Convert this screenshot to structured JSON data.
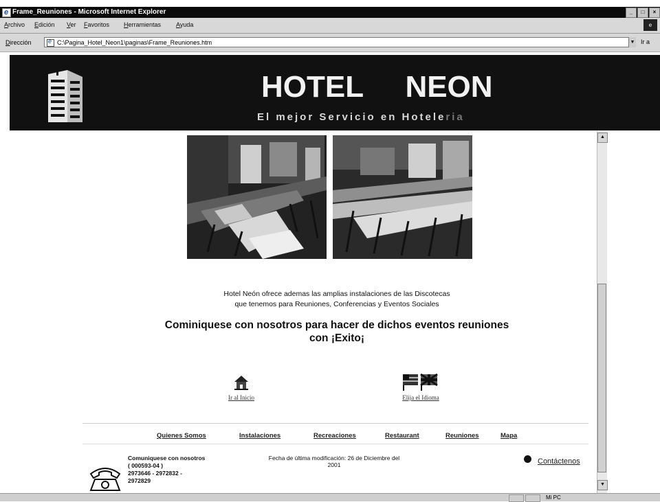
{
  "window": {
    "title": "Frame_Reuniones - Microsoft Internet Explorer"
  },
  "menu": [
    "Archivo",
    "Edición",
    "Ver",
    "Favoritos",
    "Herramientas",
    "Ayuda"
  ],
  "address": {
    "label": "Dirección",
    "value": "C:\\Pagina_Hotel_Neon1\\paginas\\Frame_Reuniones.htm",
    "go": "Ir a"
  },
  "header": {
    "title_left": "HOTEL",
    "title_right": "NEON",
    "subtitle_main": "El mejor Servicio en Hotele",
    "subtitle_fade": "ria"
  },
  "content": {
    "desc_line1": "Hotel Neón ofrece ademas las amplias instalaciones de las Discotecas",
    "desc_line2": "que tenemos para Reuniones, Conferencias y Eventos Sociales",
    "highlight_line1": "Cominiquese con nosotros para hacer de dichos eventos reuniones",
    "highlight_line2": "con ¡Exito¡"
  },
  "nav": {
    "home": "Ir al Inicio",
    "language": "Elija el Idioma"
  },
  "footer": {
    "links": [
      "Quienes Somos",
      "Instalaciones",
      "Recreaciones",
      "Restaurant",
      "Reuniones",
      "Mapa"
    ],
    "contact_title": "Comuniquese con nosotros",
    "contact_code": "( 000593-04 )",
    "contact_phones": "2973646 - 2972832 -",
    "contact_phone_last": "2972829",
    "modified_line1": "Fecha de última modificación: 26 de Diciembre del",
    "modified_line2": "2001",
    "contact_link": "Contáctenos"
  },
  "statusbar": {
    "zone": "Mi PC"
  },
  "icons": [
    "ie-logo-icon",
    "page-icon",
    "hotel-building-logo-icon",
    "home-icon",
    "flags-icon",
    "telephone-icon",
    "bullet-icon"
  ]
}
